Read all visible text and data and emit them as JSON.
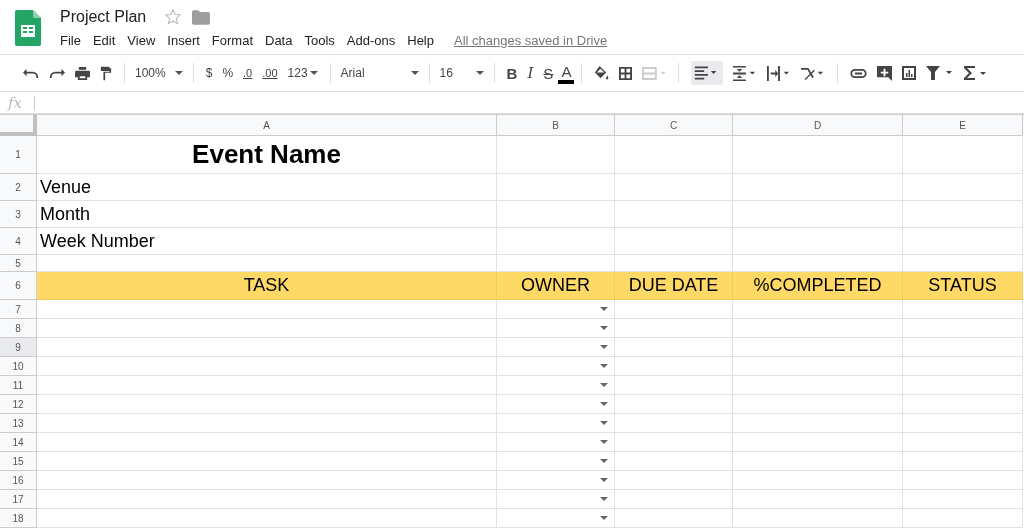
{
  "document": {
    "title": "Project Plan",
    "starred": false,
    "save_status": "All changes saved in Drive"
  },
  "menu": [
    "File",
    "Edit",
    "View",
    "Insert",
    "Format",
    "Data",
    "Tools",
    "Add-ons",
    "Help"
  ],
  "toolbar": {
    "zoom": "100%",
    "currency": "$",
    "percent_sign": "%",
    "decrease_decimals": ".0",
    "increase_decimals": ".00",
    "more_formats": "123",
    "font": "Arial",
    "font_size": "16",
    "bold": "B",
    "italic": "I",
    "strikethrough": "S",
    "text_color": "A",
    "align_pressed": true
  },
  "formula_bar": {
    "label": "fx"
  },
  "sheet": {
    "columns": [
      "A",
      "B",
      "C",
      "D",
      "E"
    ],
    "rows": [
      {
        "number": "1",
        "kind": "title",
        "selected": false,
        "cells": [
          "Event Name"
        ]
      },
      {
        "number": "2",
        "kind": "label",
        "selected": false,
        "cells": [
          "Venue"
        ]
      },
      {
        "number": "3",
        "kind": "label",
        "selected": false,
        "cells": [
          "Month"
        ]
      },
      {
        "number": "4",
        "kind": "label",
        "selected": false,
        "cells": [
          "Week Number"
        ]
      },
      {
        "number": "5",
        "kind": "blank",
        "selected": false
      },
      {
        "number": "6",
        "kind": "header",
        "selected": false,
        "cells": [
          "TASK",
          "OWNER",
          "DUE DATE",
          "%COMPLETED",
          "STATUS"
        ]
      },
      {
        "number": "7",
        "kind": "task",
        "selected": false,
        "owner_dropdown": true
      },
      {
        "number": "8",
        "kind": "task",
        "selected": false,
        "owner_dropdown": true
      },
      {
        "number": "9",
        "kind": "task",
        "selected": true,
        "owner_dropdown": true
      },
      {
        "number": "10",
        "kind": "task",
        "selected": false,
        "owner_dropdown": true
      },
      {
        "number": "11",
        "kind": "task",
        "selected": false,
        "owner_dropdown": true
      },
      {
        "number": "12",
        "kind": "task",
        "selected": false,
        "owner_dropdown": true
      },
      {
        "number": "13",
        "kind": "task",
        "selected": false,
        "owner_dropdown": true
      },
      {
        "number": "14",
        "kind": "task",
        "selected": false,
        "owner_dropdown": true
      },
      {
        "number": "15",
        "kind": "task",
        "selected": false,
        "owner_dropdown": true
      },
      {
        "number": "16",
        "kind": "task",
        "selected": false,
        "owner_dropdown": true
      },
      {
        "number": "17",
        "kind": "task",
        "selected": false,
        "owner_dropdown": true
      },
      {
        "number": "18",
        "kind": "task",
        "selected": false,
        "owner_dropdown": true
      }
    ]
  }
}
